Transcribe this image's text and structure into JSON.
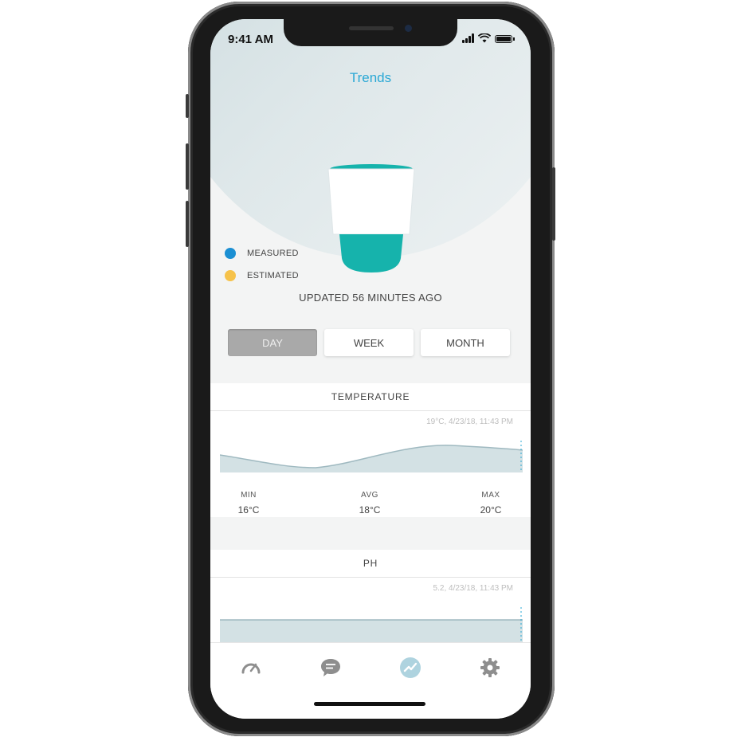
{
  "status_bar": {
    "time": "9:41 AM"
  },
  "header": {
    "title": "Trends"
  },
  "legend": [
    {
      "label": "MEASURED",
      "color": "#1b8fd3"
    },
    {
      "label": "ESTIMATED",
      "color": "#f6c24a"
    }
  ],
  "updated_text": "UPDATED 56 MINUTES AGO",
  "range_tabs": [
    {
      "label": "DAY",
      "selected": true
    },
    {
      "label": "WEEK",
      "selected": false
    },
    {
      "label": "MONTH",
      "selected": false
    }
  ],
  "temperature": {
    "title": "TEMPERATURE",
    "latest": "19°C, 4/23/18, 11:43 PM",
    "min_label": "MIN",
    "min_value": "16°C",
    "avg_label": "AVG",
    "avg_value": "18°C",
    "max_label": "MAX",
    "max_value": "20°C"
  },
  "ph": {
    "title": "PH",
    "latest": "5.2, 4/23/18, 11:43 PM"
  },
  "tabbar": {
    "items": [
      {
        "icon": "gauge-icon"
      },
      {
        "icon": "chat-bubble-icon"
      },
      {
        "icon": "trends-icon",
        "active": true
      },
      {
        "icon": "gear-icon"
      }
    ]
  },
  "colors": {
    "accent": "#2aa8d5",
    "teal": "#16b3ac",
    "chart_fill": "#d3e1e4",
    "chart_line": "#9fb9c0"
  }
}
